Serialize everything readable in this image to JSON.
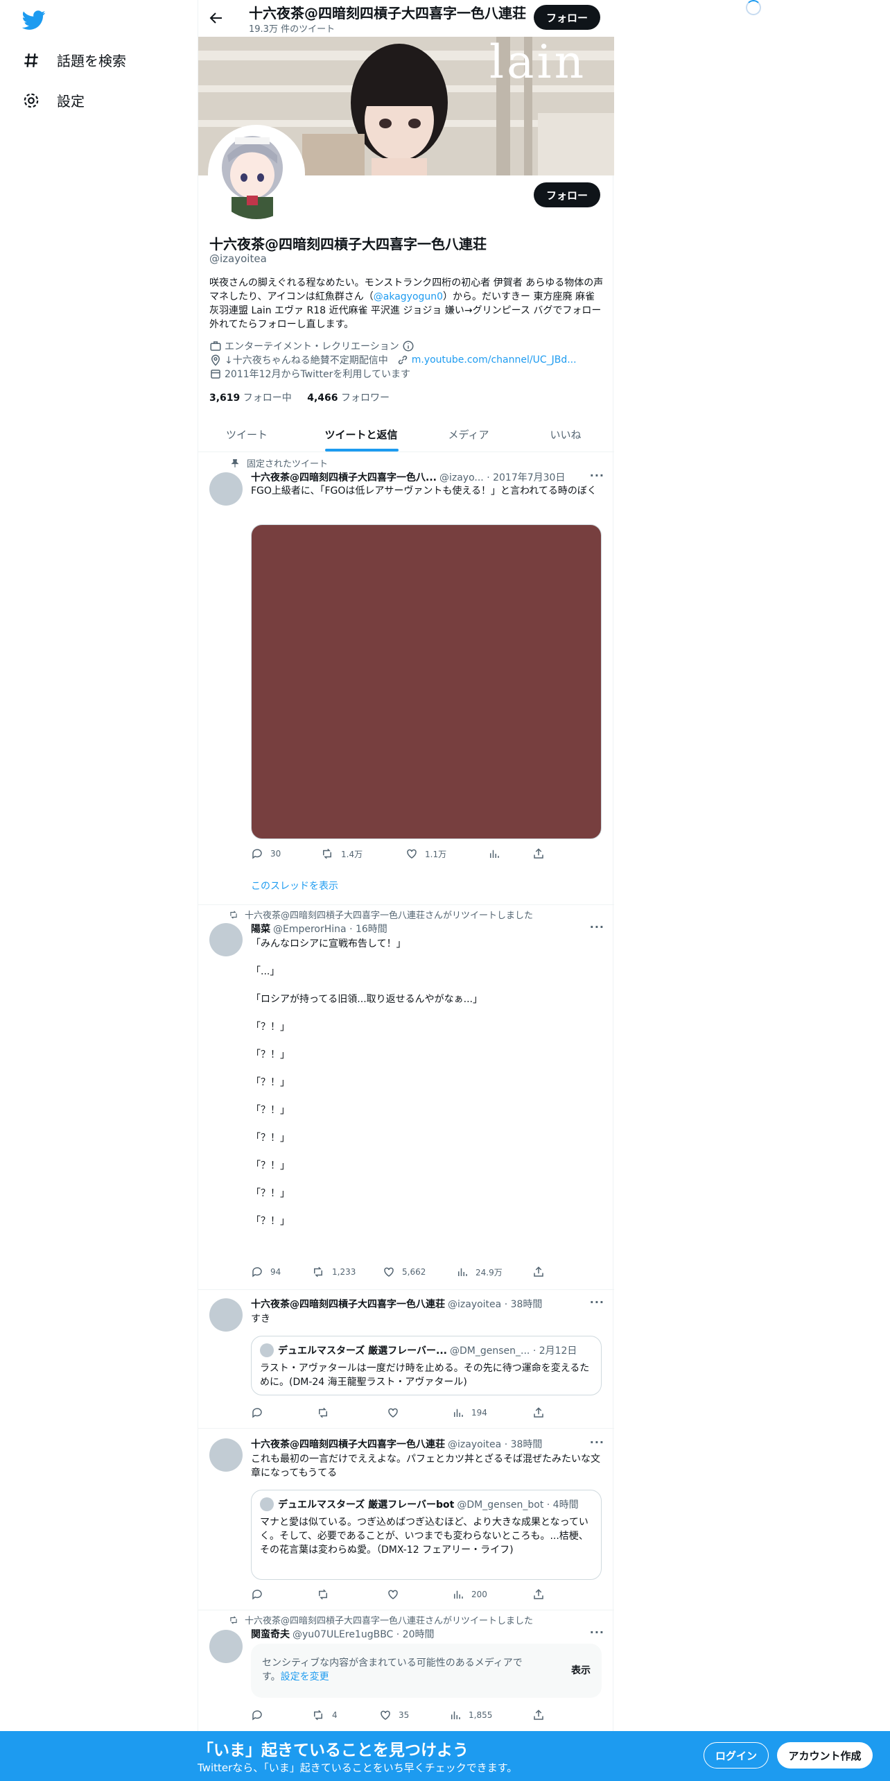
{
  "nav": {
    "explore": "話題を検索",
    "settings": "設定"
  },
  "header": {
    "name": "十六夜茶@四暗刻四槓子大四喜字一色八連荘",
    "tweet_count": "19.3万 件のツイート",
    "follow": "フォロー"
  },
  "banner": {
    "text": "lain"
  },
  "profile": {
    "name": "十六夜茶@四暗刻四槓子大四喜字一色八連荘",
    "handle": "@izayoitea",
    "follow": "フォロー",
    "bio_1": "咲夜さんの脚えぐれる程なめたい。モンストランク四桁の初心者 伊賀者 あらゆる物体の声マネしたり、アイコンは紅魚群さん（",
    "bio_link": "@akagyogun0",
    "bio_2": "）から。だいすきー 東方座廃 麻雀 灰羽連盟 Lain エヴァ R18 近代麻雀 平沢進 ジョジョ 嫌い→グリンピース バグでフォロー外れてたらフォローし直します。",
    "category": "エンターテイメント・レクリエーション",
    "location": "↓十六夜ちゃんねる絶賛不定期配信中",
    "url": "m.youtube.com/channel/UC_JBd...",
    "joined": "2011年12月からTwitterを利用しています",
    "following_count": "3,619",
    "following_label": "フォロー中",
    "followers_count": "4,466",
    "followers_label": "フォロワー"
  },
  "tabs": [
    "ツイート",
    "ツイートと返信",
    "メディア",
    "いいね"
  ],
  "tweets": [
    {
      "social": "固定されたツイート",
      "name": "十六夜茶@四暗刻四槓子大四喜字一色八...",
      "meta": "@izayo... · 2017年7月30日",
      "text": "FGO上級者に、「FGOは低レアサーヴァントも使える！」と言われてる時のぼく",
      "replies": "30",
      "retweets": "1.4万",
      "likes": "1.1万",
      "show_thread": "このスレッドを表示"
    },
    {
      "social": "十六夜茶@四暗刻四槓子大四喜字一色八連荘さんがリツイートしました",
      "name": "陽菜",
      "meta": "@EmperorHina · 16時間",
      "text": "「みんなロシアに宣戦布告して！」\n\n「...」\n\n「ロシアが持ってる旧領...取り返せるんやがなぁ...」\n\n「？！」\n\n「？！」\n\n「？！」\n\n「？！」\n\n「？！」\n\n「？！」\n\n「？！」\n\n「？！」",
      "replies": "94",
      "retweets": "1,233",
      "likes": "5,662",
      "views": "24.9万"
    },
    {
      "name": "十六夜茶@四暗刻四槓子大四喜字一色八連荘",
      "meta": "@izayoitea · 38時間",
      "text": "すき",
      "quote_name": "デュエルマスターズ 厳選フレーバー...",
      "quote_meta": "@DM_gensen_... · 2月12日",
      "quote_text": "ラスト・アヴァタールは一度だけ時を止める。その先に待つ運命を変えるために。(DM-24 海王龍聖ラスト・アヴァタール)",
      "views": "194"
    },
    {
      "name": "十六夜茶@四暗刻四槓子大四喜字一色八連荘",
      "meta": "@izayoitea · 38時間",
      "text": "これも最初の一言だけでええよな。パフェとカツ丼とざるそば混ぜたみたいな文章になってもうてる",
      "quote_name": "デュエルマスターズ 厳選フレーバーbot",
      "quote_meta": "@DM_gensen_bot · 4時間",
      "quote_text": "マナと愛は似ている。つぎ込めばつぎ込むほど、より大きな成果となっていく。そして、必要であることが、いつまでも変わらないところも。...桔梗、その花言葉は変わらぬ愛。（DMX-12 フェアリー・ライフ)",
      "views": "200"
    },
    {
      "social": "十六夜茶@四暗刻四槓子大四喜字一色八連荘さんがリツイートしました",
      "name": "関蛮奇夫",
      "meta": "@yu07ULEre1ugBBC · 20時間",
      "sensitive": "センシティブな内容が含まれている可能性のあるメディアです。",
      "sensitive_link": "設定を変更",
      "show": "表示",
      "retweets": "4",
      "likes": "35",
      "views": "1,855"
    }
  ],
  "bottom": {
    "title": "「いま」起きていることを見つけよう",
    "subtitle": "Twitterなら、「いま」起きていることをいち早くチェックできます。",
    "login": "ログイン",
    "signup": "アカウント作成"
  },
  "colors": {
    "accent": "#1d9bf0",
    "text": "#0f1419",
    "muted": "#536471",
    "media": "#773f3f"
  }
}
